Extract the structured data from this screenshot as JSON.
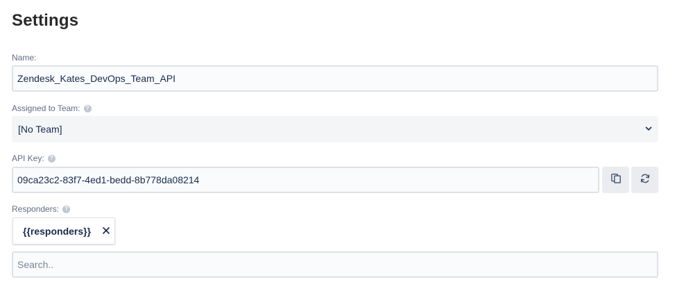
{
  "page": {
    "title": "Settings"
  },
  "name_field": {
    "label": "Name:",
    "value": "Zendesk_Kates_DevOps_Team_API"
  },
  "team_field": {
    "label": "Assigned to Team:",
    "selected": "[No Team]"
  },
  "api_key_field": {
    "label": "API Key:",
    "value": "09ca23c2-83f7-4ed1-bedd-8b778da08214",
    "copy_icon": "copy-icon",
    "regenerate_icon": "refresh-icon"
  },
  "responders_field": {
    "label": "Responders:",
    "chips": [
      {
        "label": "{{responders}}"
      }
    ],
    "search_placeholder": "Search.."
  },
  "help_icon_glyph": "?",
  "colors": {
    "input_border": "#dfe1e6",
    "input_bg": "#fafbfc",
    "select_bg": "#f4f5f7",
    "button_bg": "#ebecf0",
    "label": "#5e6c84",
    "text": "#172b4d"
  }
}
